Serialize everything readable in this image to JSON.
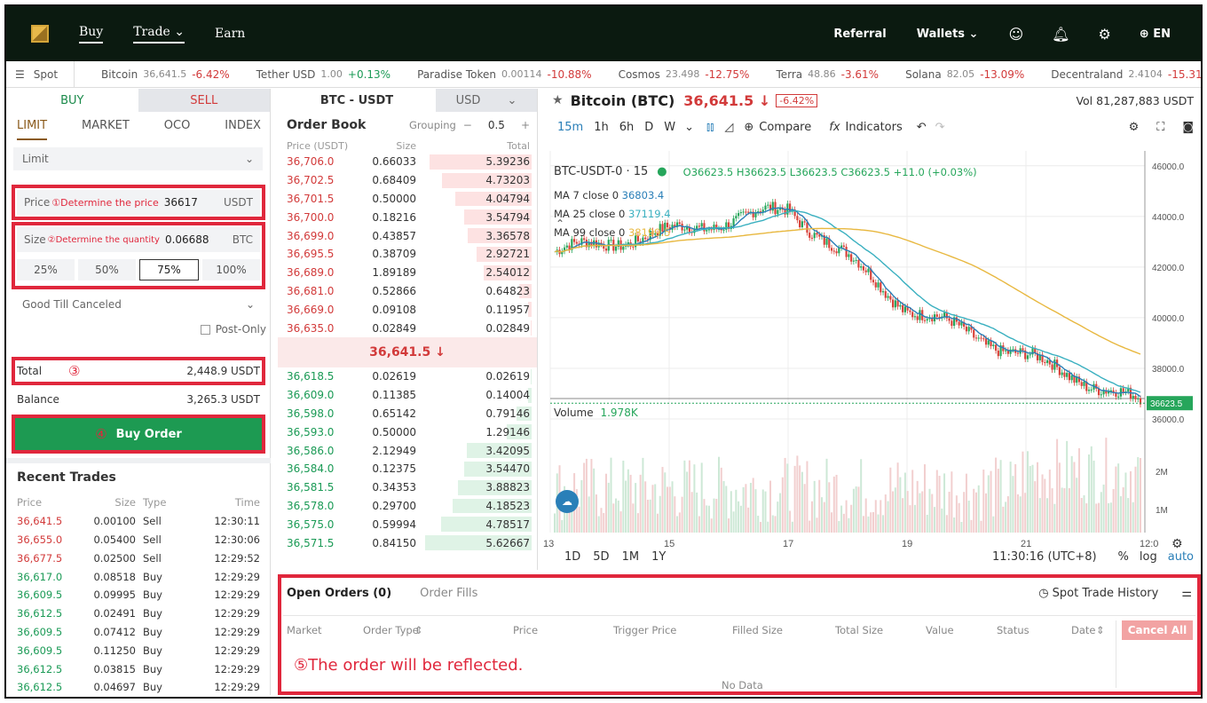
{
  "nav": {
    "items": [
      "Buy",
      "Trade",
      "Earn"
    ],
    "referral": "Referral",
    "wallets": "Wallets",
    "lang": "EN"
  },
  "ticker": {
    "spot": "Spot",
    "items": [
      {
        "name": "Bitcoin",
        "price": "36,641.5",
        "change": "-6.42%"
      },
      {
        "name": "Tether USD",
        "price": "1.00",
        "change": "+0.13%"
      },
      {
        "name": "Paradise Token",
        "price": "0.00114",
        "change": "-10.88%"
      },
      {
        "name": "Cosmos",
        "price": "23.498",
        "change": "-12.75%"
      },
      {
        "name": "Terra",
        "price": "48.86",
        "change": "-3.61%"
      },
      {
        "name": "Solana",
        "price": "82.05",
        "change": "-13.09%"
      },
      {
        "name": "Decentraland",
        "price": "2.4104",
        "change": "-15.31"
      }
    ]
  },
  "order_form": {
    "buy_tab": "BUY",
    "sell_tab": "SELL",
    "types": [
      "LIMIT",
      "MARKET",
      "OCO",
      "INDEX"
    ],
    "type_select": "Limit",
    "price_label": "Price",
    "price_annotation": "①Determine the price",
    "price_value": "36617",
    "price_unit": "USDT",
    "size_label": "Size",
    "size_annotation": "②Determine the quantity",
    "size_value": "0.06688",
    "size_unit": "BTC",
    "pcts": [
      "25%",
      "50%",
      "75%",
      "100%"
    ],
    "tif": "Good Till Canceled",
    "post_only": "Post-Only",
    "total_label": "Total",
    "total_annotation": "③",
    "total_value": "2,448.9 USDT",
    "balance_label": "Balance",
    "balance_value": "3,265.3 USDT",
    "buy_annotation": "④",
    "buy_button": "Buy Order"
  },
  "recent_trades": {
    "title": "Recent Trades",
    "headers": [
      "Price",
      "Size",
      "Type",
      "Time"
    ],
    "rows": [
      [
        "36,641.5",
        "0.00100",
        "Sell",
        "12:30:11"
      ],
      [
        "36,655.0",
        "0.05400",
        "Sell",
        "12:30:06"
      ],
      [
        "36,677.5",
        "0.02500",
        "Sell",
        "12:29:52"
      ],
      [
        "36,617.0",
        "0.08518",
        "Buy",
        "12:29:29"
      ],
      [
        "36,609.5",
        "0.09995",
        "Buy",
        "12:29:29"
      ],
      [
        "36,612.5",
        "0.02491",
        "Buy",
        "12:29:29"
      ],
      [
        "36,609.5",
        "0.07412",
        "Buy",
        "12:29:29"
      ],
      [
        "36,609.5",
        "0.11250",
        "Buy",
        "12:29:29"
      ],
      [
        "36,612.5",
        "0.03815",
        "Buy",
        "12:29:29"
      ],
      [
        "36,612.5",
        "0.04697",
        "Buy",
        "12:29:29"
      ]
    ]
  },
  "order_book": {
    "pair": "BTC - USDT",
    "quote": "USD",
    "title": "Order Book",
    "grouping_label": "Grouping",
    "grouping_value": "0.5",
    "headers": [
      "Price (USDT)",
      "Size",
      "Total"
    ],
    "asks": [
      [
        "36,706.0",
        "0.66033",
        "5.39236",
        0.96
      ],
      [
        "36,702.5",
        "0.68409",
        "4.73203",
        0.84
      ],
      [
        "36,701.5",
        "0.50000",
        "4.04794",
        0.72
      ],
      [
        "36,700.0",
        "0.18216",
        "3.54794",
        0.63
      ],
      [
        "36,699.0",
        "0.43857",
        "3.36578",
        0.6
      ],
      [
        "36,695.5",
        "0.38709",
        "2.92721",
        0.52
      ],
      [
        "36,689.0",
        "1.89189",
        "2.54012",
        0.45
      ],
      [
        "36,681.0",
        "0.52866",
        "0.64823",
        0.12
      ],
      [
        "36,669.0",
        "0.09108",
        "0.11957",
        0.03
      ],
      [
        "36,635.0",
        "0.02849",
        "0.02849",
        0.01
      ]
    ],
    "mid": "36,641.5 ↓",
    "bids": [
      [
        "36,618.5",
        "0.02619",
        "0.02619",
        0.01
      ],
      [
        "36,609.0",
        "0.11385",
        "0.14004",
        0.03
      ],
      [
        "36,598.0",
        "0.65142",
        "0.79146",
        0.14
      ],
      [
        "36,593.0",
        "0.50000",
        "1.29146",
        0.23
      ],
      [
        "36,586.0",
        "2.12949",
        "3.42095",
        0.61
      ],
      [
        "36,584.0",
        "0.12375",
        "3.54470",
        0.63
      ],
      [
        "36,581.5",
        "0.34353",
        "3.88823",
        0.69
      ],
      [
        "36,578.0",
        "0.29700",
        "4.18523",
        0.74
      ],
      [
        "36,575.0",
        "0.59994",
        "4.78517",
        0.85
      ],
      [
        "36,571.5",
        "0.84150",
        "5.62667",
        1.0
      ]
    ]
  },
  "chart": {
    "title": "Bitcoin (BTC)",
    "price": "36,641.5 ↓",
    "change": "-6.42%",
    "vol": "Vol 81,287,883 USDT",
    "intervals": [
      "15m",
      "1h",
      "6h",
      "D",
      "W"
    ],
    "compare": "Compare",
    "indicators": "Indicators",
    "symbol": "BTC-USDT-0 · 15",
    "ohlc": "O36623.5 H36623.5 L36623.5 C36623.5 +11.0 (+0.03%)",
    "ma7": "MA 7 close 0",
    "ma7v": "36803.4",
    "ma25": "MA 25 close 0",
    "ma25v": "37119.4",
    "ma99": "MA 99 close 0",
    "ma99v": "38199.5",
    "yticks": [
      "46000.0",
      "44000.0",
      "42000.0",
      "40000.0",
      "38000.0",
      "36000.0"
    ],
    "last": "36623.5",
    "volume_label": "Volume",
    "volume_value": "1.978K",
    "vticks": [
      "2M",
      "1M"
    ],
    "xticks": [
      "13",
      "15",
      "17",
      "19",
      "21",
      "12:0"
    ],
    "ranges": [
      "1D",
      "5D",
      "1M",
      "1Y"
    ],
    "clock": "11:30:16 (UTC+8)",
    "pct": "%",
    "log": "log",
    "auto": "auto",
    "colors": {
      "ma7": "#2a7fb8",
      "ma25": "#3ab0c0",
      "ma99": "#e8b840",
      "up": "#26a65b",
      "down": "#d9433b"
    }
  },
  "chart_data": {
    "type": "line",
    "x": [
      "13",
      "15",
      "17",
      "19",
      "21",
      "12:0"
    ],
    "series": [
      {
        "values": [
          42600,
          43400,
          44300,
          40400,
          38500,
          36623.5
        ]
      }
    ],
    "ylim": [
      36000,
      46000
    ]
  },
  "bottom": {
    "tab_open": "Open Orders (0)",
    "tab_fills": "Order Fills",
    "history": "Spot Trade History",
    "headers": [
      "Market",
      "Order Type",
      "Price",
      "Trigger Price",
      "Filled Size",
      "Total Size",
      "Value",
      "Status",
      "Date"
    ],
    "cancel_all": "Cancel All",
    "annotation": "⑤The order will be reflected.",
    "no_data": "No Data"
  }
}
